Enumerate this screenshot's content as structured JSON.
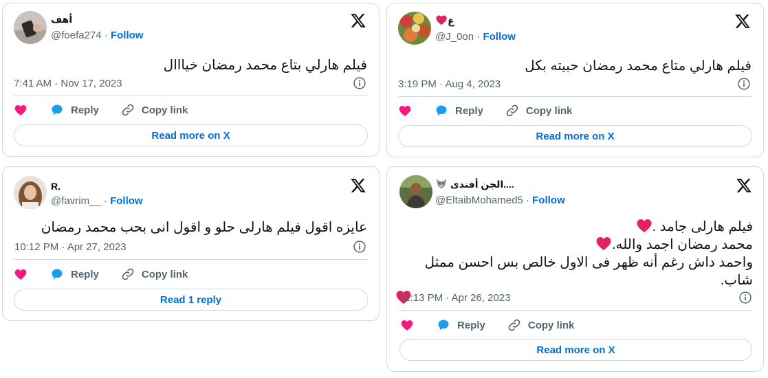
{
  "tweets": [
    {
      "name": "أهف",
      "handle": "@foefa274",
      "follow": "Follow",
      "text": "فيلم هارلي بتاع محمد رمضان خيااال",
      "timestamp": "7:41 AM · Nov 17, 2023",
      "like_icon": "heart-icon",
      "reply": "Reply",
      "copy": "Copy link",
      "cta": "Read more on X"
    },
    {
      "name": "غ",
      "handle": "@J_0on",
      "follow": "Follow",
      "text": "فيلم هارلي متاع محمد رمضان حبيته بكل",
      "timestamp": "3:19 PM · Aug 4, 2023",
      "reply": "Reply",
      "copy": "Copy link",
      "cta": "Read more on X"
    },
    {
      "name": "R.",
      "handle": "@favrim__",
      "follow": "Follow",
      "text": "عايزه اقول فيلم هارلى حلو و اقول انى بحب محمد رمضان",
      "timestamp": "10:12 PM · Apr 27, 2023",
      "reply": "Reply",
      "copy": "Copy link",
      "cta": "Read 1 reply"
    },
    {
      "name": "الجن أفندى....",
      "handle": "@EltaibMohamed5",
      "follow": "Follow",
      "lines": [
        "فيلم هارلى جامد .",
        "محمد رمضان اجمد والله.",
        "واحمد داش رغم أنه ظهر فى الاول خالص بس احسن ممثل شاب."
      ],
      "timestamp": "11:13 PM · Apr 26, 2023",
      "reply": "Reply",
      "copy": "Copy link",
      "cta": "Read more on X"
    }
  ],
  "colors": {
    "heart": "#f91880",
    "emoji_heart": "#e0245e",
    "link": "#006fd6",
    "reply_bubble": "#1d9bf0",
    "muted": "#536471",
    "border": "#cfd9de"
  }
}
